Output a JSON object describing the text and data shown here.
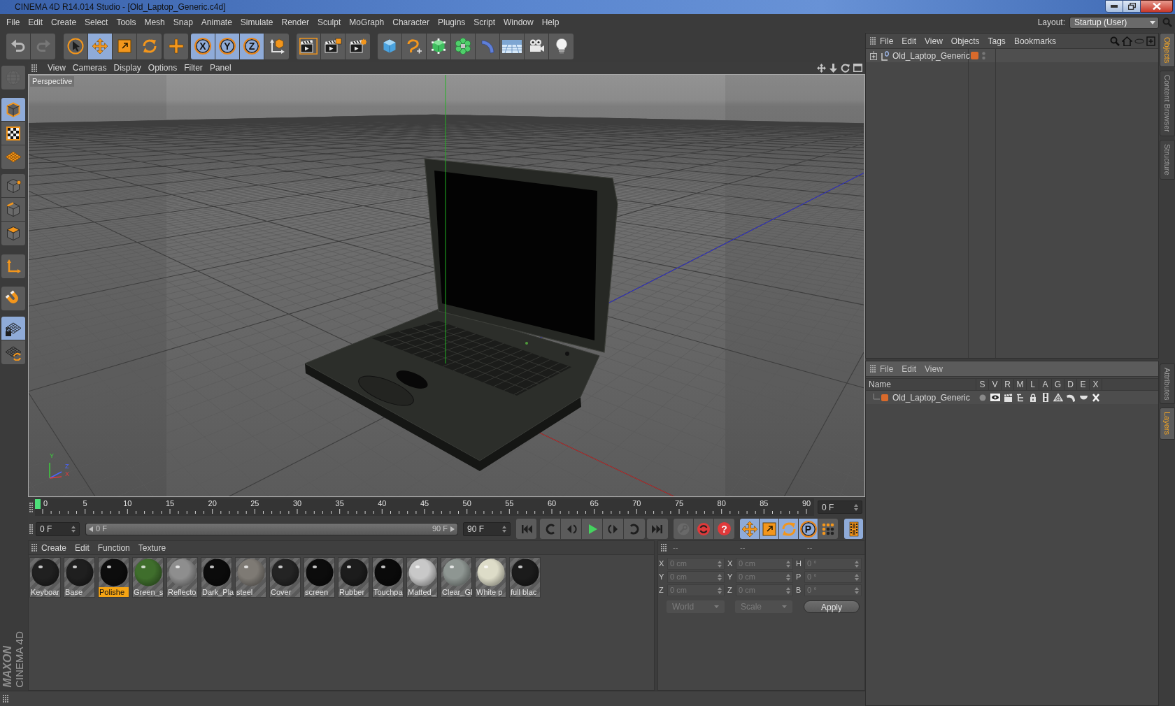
{
  "window": {
    "title": "CINEMA 4D R14.014 Studio - [Old_Laptop_Generic.c4d]"
  },
  "menu_bar": [
    "File",
    "Edit",
    "Create",
    "Select",
    "Tools",
    "Mesh",
    "Snap",
    "Animate",
    "Simulate",
    "Render",
    "Sculpt",
    "MoGraph",
    "Character",
    "Plugins",
    "Script",
    "Window",
    "Help"
  ],
  "layout": {
    "label": "Layout:",
    "value": "Startup (User)"
  },
  "main_toolbar": {
    "groups": [
      [
        {
          "selected": false,
          "disabled": false
        },
        {
          "selected": false,
          "disabled": true
        }
      ],
      [
        {
          "selected": false,
          "disabled": false
        },
        {
          "selected": true,
          "disabled": false
        },
        {
          "selected": false,
          "disabled": false
        },
        {
          "selected": false,
          "disabled": false
        }
      ],
      [
        {
          "selected": false,
          "disabled": false
        }
      ],
      [
        {
          "label": "X",
          "selected": true,
          "disabled": false
        },
        {
          "label": "Y",
          "selected": true,
          "disabled": false
        },
        {
          "label": "Z",
          "selected": true,
          "disabled": false
        },
        {
          "selected": false,
          "disabled": false
        }
      ],
      [
        {
          "selected": false,
          "disabled": false
        },
        {
          "selected": false,
          "disabled": false
        },
        {
          "selected": false,
          "disabled": false
        }
      ],
      [
        {
          "selected": false,
          "disabled": false
        },
        {
          "selected": false,
          "disabled": false
        },
        {
          "selected": false,
          "disabled": false
        },
        {
          "selected": false,
          "disabled": false
        },
        {
          "selected": false,
          "disabled": false
        },
        {
          "selected": false,
          "disabled": false
        },
        {
          "selected": false,
          "disabled": false
        },
        {
          "selected": false,
          "disabled": false
        }
      ]
    ]
  },
  "mode_toolbar": {
    "groups": [
      [
        {
          "selected": false,
          "disabled": true
        }
      ],
      [
        {
          "selected": true,
          "disabled": false
        },
        {
          "selected": false,
          "disabled": false
        },
        {
          "selected": false,
          "disabled": false
        }
      ],
      [
        {
          "selected": false,
          "disabled": false
        },
        {
          "selected": false,
          "disabled": false
        },
        {
          "selected": false,
          "disabled": false
        }
      ],
      [
        {
          "selected": false,
          "disabled": false
        }
      ],
      [
        {
          "selected": false,
          "disabled": false
        }
      ],
      [
        {
          "selected": true,
          "disabled": false
        },
        {
          "selected": false,
          "disabled": false
        }
      ]
    ]
  },
  "logo": {
    "brand": "MAXON",
    "product": "CINEMA 4D"
  },
  "viewport": {
    "menu": [
      "View",
      "Cameras",
      "Display",
      "Options",
      "Filter",
      "Panel"
    ],
    "camera": "Perspective",
    "axis_labels": [
      "Y",
      "Z",
      "X"
    ]
  },
  "timeline": {
    "ticks": [
      "0",
      "5",
      "10",
      "15",
      "20",
      "25",
      "30",
      "35",
      "40",
      "45",
      "50",
      "55",
      "60",
      "65",
      "70",
      "75",
      "80",
      "85",
      "90"
    ],
    "level": 0,
    "current_frame": "0 F"
  },
  "playback": {
    "start_frame": "0 F",
    "range": {
      "start": "0 F",
      "end": "90 F",
      "level": 1
    },
    "end_frame": "90 F",
    "key_buttons": [
      {
        "disabled": true
      },
      {
        "disabled": false
      }
    ],
    "help_button": {
      "label": "?"
    },
    "toggles": [
      {
        "selected": true
      },
      {
        "selected": true
      },
      {
        "selected": true
      },
      {
        "label": "P",
        "selected": true
      },
      {
        "selected": false
      }
    ],
    "timeline_button": {
      "selected": true
    }
  },
  "material_manager": {
    "menu": [
      "Create",
      "Edit",
      "Function",
      "Texture"
    ],
    "materials": [
      {
        "name": "Keyboar",
        "color": "#202020",
        "selected": false
      },
      {
        "name": "Base",
        "color": "#1f1f1f",
        "selected": false
      },
      {
        "name": "Polishe",
        "color": "#0d0d0d",
        "selected": true
      },
      {
        "name": "Green_s",
        "color": "#3f6e2c",
        "selected": false
      },
      {
        "name": "Reflecto",
        "color": "#8e8e8e",
        "selected": false
      },
      {
        "name": "Dark_Pla",
        "color": "#0b0b0b",
        "selected": false
      },
      {
        "name": "steel",
        "color": "#7e7a74",
        "selected": false
      },
      {
        "name": "Cover",
        "color": "#242424",
        "selected": false
      },
      {
        "name": "screen",
        "color": "#0c0c0c",
        "selected": false
      },
      {
        "name": "Rubber",
        "color": "#1c1c1c",
        "selected": false
      },
      {
        "name": "Touchpa",
        "color": "#0a0a0a",
        "selected": false
      },
      {
        "name": "Matted_",
        "color": "#c8c8c8",
        "selected": false
      },
      {
        "name": "Clear_Gl",
        "color": "#8e9692",
        "selected": false
      },
      {
        "name": "White p",
        "color": "#dddcc8",
        "selected": false
      },
      {
        "name": "full blac",
        "color": "#1b1b1b",
        "selected": false
      }
    ]
  },
  "coordinates": {
    "headers": [
      "--",
      "--",
      "--"
    ],
    "columns": [
      [
        {
          "label": "X",
          "value": "0 cm",
          "disabled": true
        },
        {
          "label": "Y",
          "value": "0 cm",
          "disabled": true
        },
        {
          "label": "Z",
          "value": "0 cm",
          "disabled": true
        }
      ],
      [
        {
          "label": "X",
          "value": "0 cm",
          "disabled": true
        },
        {
          "label": "Y",
          "value": "0 cm",
          "disabled": true
        },
        {
          "label": "Z",
          "value": "0 cm",
          "disabled": true
        }
      ],
      [
        {
          "label": "H",
          "value": "0 °",
          "disabled": true
        },
        {
          "label": "P",
          "value": "0 °",
          "disabled": true
        },
        {
          "label": "B",
          "value": "0 °",
          "disabled": true
        }
      ]
    ],
    "dropdowns": [
      {
        "value": "World",
        "disabled": true
      },
      {
        "value": "Scale",
        "disabled": true
      }
    ],
    "apply": {
      "label": "Apply",
      "disabled": false
    }
  },
  "object_manager": {
    "menu": [
      "File",
      "Edit",
      "View",
      "Objects",
      "Tags",
      "Bookmarks"
    ],
    "objects": [
      {
        "name": "Old_Laptop_Generic",
        "expanded": false,
        "color": "#d96a2b"
      }
    ]
  },
  "layer_manager": {
    "menu": [
      "File",
      "Edit",
      "View"
    ],
    "columns": [
      "Name",
      "S",
      "V",
      "R",
      "M",
      "L",
      "A",
      "G",
      "D",
      "E",
      "X"
    ],
    "layers": [
      {
        "name": "Old_Laptop_Generic",
        "color": "#d96a2b",
        "flags": [
          {
            "on": false
          },
          {
            "on": true
          },
          {
            "on": true
          },
          {
            "on": true
          },
          {
            "on": true
          },
          {
            "on": true
          },
          {
            "on": true
          },
          {
            "on": true
          },
          {
            "on": true
          },
          {
            "on": true
          }
        ]
      }
    ]
  },
  "side_tabs": {
    "top": [
      {
        "label": "Objects",
        "selected": true
      },
      {
        "label": "Content Browser",
        "selected": false
      },
      {
        "label": "Structure",
        "selected": false
      }
    ],
    "bottom": [
      {
        "label": "Attributes",
        "selected": false
      },
      {
        "label": "Layers",
        "selected": true
      }
    ]
  }
}
